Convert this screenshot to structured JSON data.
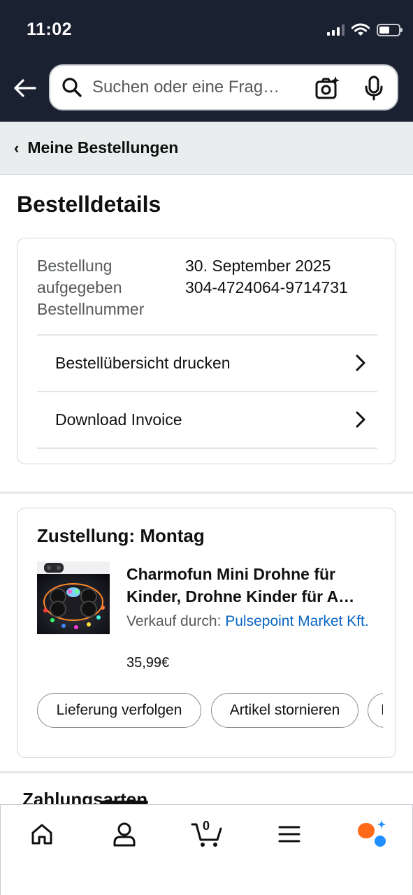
{
  "status_bar": {
    "time": "11:02"
  },
  "search": {
    "placeholder": "Suchen oder eine Frag…"
  },
  "breadcrumb": {
    "label": "Meine Bestellungen"
  },
  "page": {
    "title": "Bestelldetails"
  },
  "order_info": {
    "label_placed_line1": "Bestellung",
    "label_placed_line2": "aufgegeben",
    "label_number": "Bestellnummer",
    "date": "30. September 2025",
    "number": "304-4724064-9714731",
    "print_label": "Bestellübersicht drucken",
    "invoice_label": "Download Invoice"
  },
  "delivery": {
    "title": "Zustellung: Montag",
    "product_title_line1": "Charmofun Mini Drohne für",
    "product_title_line2": "Kinder, Drohne Kinder für A…",
    "seller_prefix": "Verkauf durch: ",
    "seller_name": "Pulsepoint Market Kft.",
    "price": "35,99€",
    "actions": [
      "Lieferung verfolgen",
      "Artikel stornieren",
      "I"
    ]
  },
  "payment": {
    "title": "Zahlungsarten"
  },
  "bottom_nav": {
    "cart_count": "0",
    "icons": [
      "home-icon",
      "account-icon",
      "cart-icon",
      "menu-icon",
      "rufus-ai-icon"
    ]
  },
  "colors": {
    "header_bg": "#1a2130",
    "breadcrumb_bg": "#eaeded",
    "link": "#0a66c2",
    "ai_orange": "#ff6a1a",
    "ai_blue": "#1f8fff"
  }
}
